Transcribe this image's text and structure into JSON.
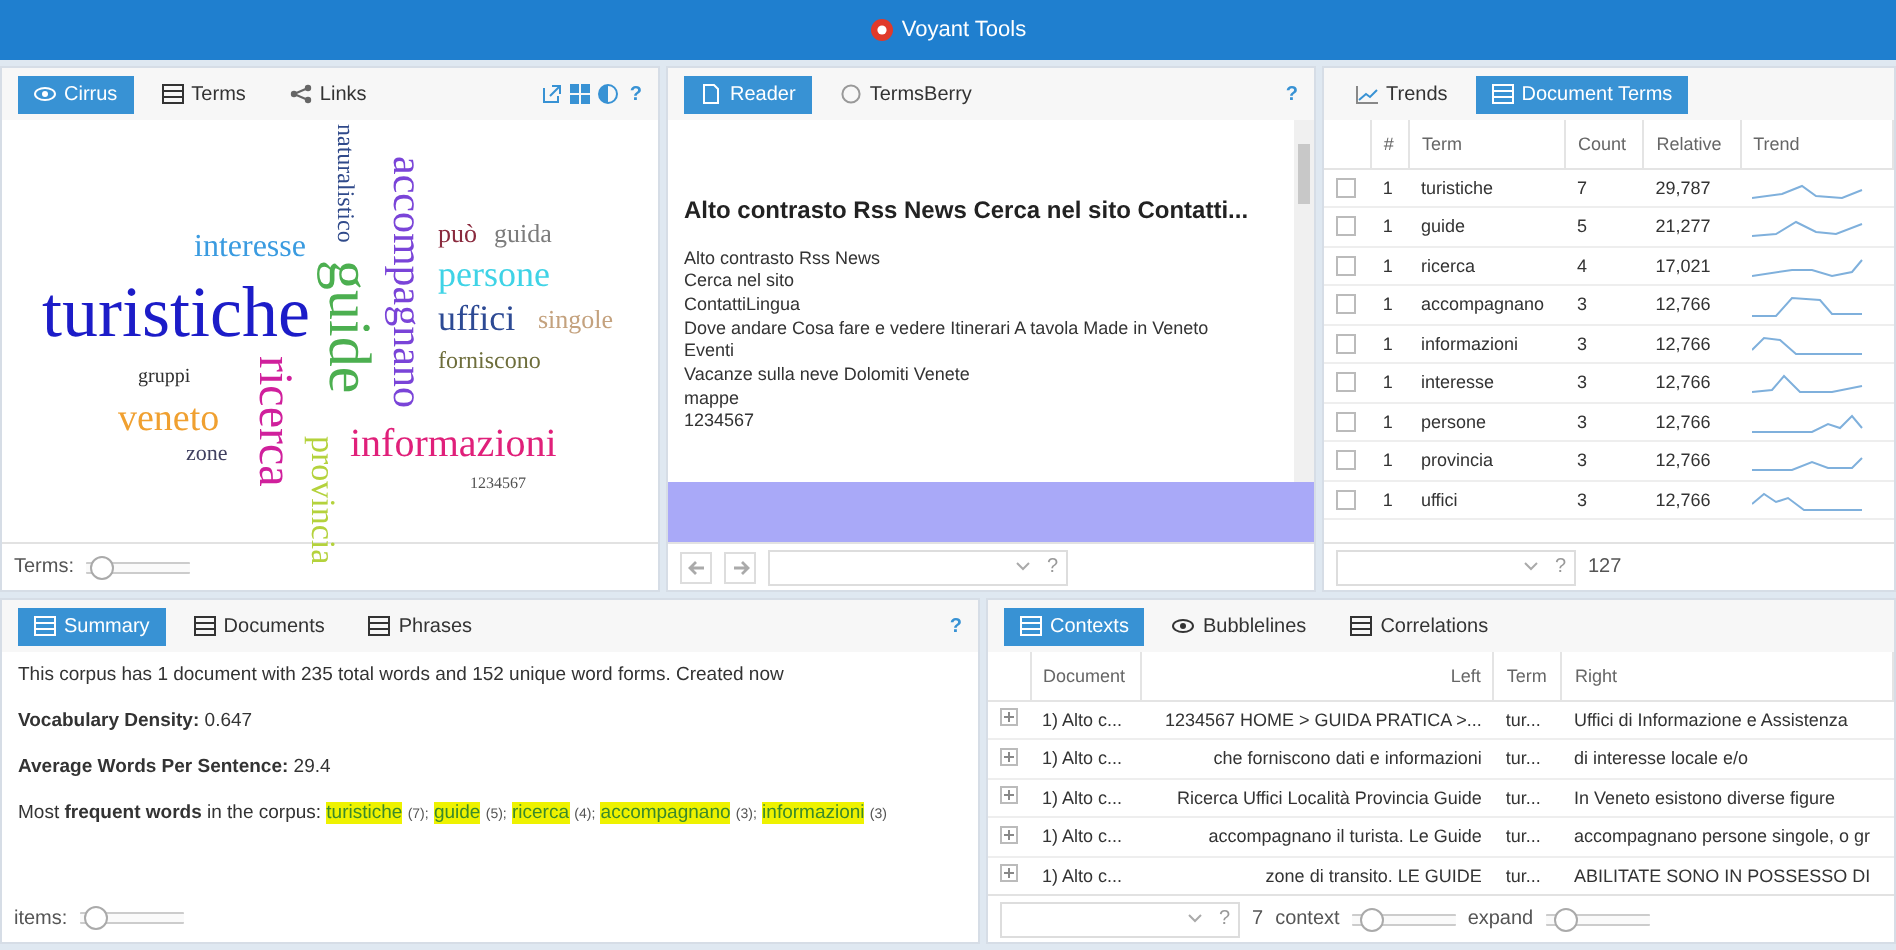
{
  "window": {
    "title": "Voyant Tools"
  },
  "cirrus": {
    "tabs": [
      {
        "label": "Cirrus",
        "selected": true
      },
      {
        "label": "Terms",
        "selected": false
      },
      {
        "label": "Links",
        "selected": false
      }
    ],
    "help": "?",
    "words": [
      {
        "text": "naturalistico",
        "color": "#304a8a"
      },
      {
        "text": "accompagnano",
        "color": "#7a44d8"
      },
      {
        "text": "può",
        "color": "#8a2a3e"
      },
      {
        "text": "guida",
        "color": "#7c7c7c"
      },
      {
        "text": "interesse",
        "color": "#3a9be0"
      },
      {
        "text": "persone",
        "color": "#3fd3e6"
      },
      {
        "text": "guide",
        "color": "#4caf50"
      },
      {
        "text": "turistiche",
        "color": "#1c1cc8"
      },
      {
        "text": "uffici",
        "color": "#2d4a94"
      },
      {
        "text": "singole",
        "color": "#c4a27e"
      },
      {
        "text": "forniscono",
        "color": "#6e6e3c"
      },
      {
        "text": "ricerca",
        "color": "#d0209c"
      },
      {
        "text": "gruppi",
        "color": "#303030"
      },
      {
        "text": "veneto",
        "color": "#f0a030"
      },
      {
        "text": "zone",
        "color": "#404060"
      },
      {
        "text": "informazioni",
        "color": "#e0207a"
      },
      {
        "text": "provincia",
        "color": "#b4d23c"
      },
      {
        "text": "1234567",
        "color": "#505050"
      }
    ],
    "slider": {
      "label": "Terms:",
      "level": 0.05
    }
  },
  "reader": {
    "tabs": [
      {
        "label": "Reader",
        "selected": true
      },
      {
        "label": "TermsBerry",
        "selected": false
      }
    ],
    "help": "?",
    "title": "Alto contrasto Rss News Cerca nel sito Contatti...",
    "lines": [
      "Alto contrasto Rss News",
      "Cerca nel sito",
      "ContattiLingua",
      "Dove andare Cosa fare e vedere Itinerari A tavola Made in Veneto",
      "Eventi",
      "Vacanze sulla neve Dolomiti Venete",
      "mappe",
      "1234567"
    ],
    "help_footer": "?"
  },
  "document_terms": {
    "tabs": [
      {
        "label": "Trends",
        "selected": false
      },
      {
        "label": "Document Terms",
        "selected": true
      }
    ],
    "columns": [
      "#",
      "Term",
      "Count",
      "Relative",
      "Trend"
    ],
    "rows": [
      {
        "checked": false,
        "doc": "1",
        "term": "turistiche",
        "count": "7",
        "relative": "29,787"
      },
      {
        "checked": false,
        "doc": "1",
        "term": "guide",
        "count": "5",
        "relative": "21,277"
      },
      {
        "checked": false,
        "doc": "1",
        "term": "ricerca",
        "count": "4",
        "relative": "17,021"
      },
      {
        "checked": false,
        "doc": "1",
        "term": "accompagnano",
        "count": "3",
        "relative": "12,766"
      },
      {
        "checked": false,
        "doc": "1",
        "term": "informazioni",
        "count": "3",
        "relative": "12,766"
      },
      {
        "checked": false,
        "doc": "1",
        "term": "interesse",
        "count": "3",
        "relative": "12,766"
      },
      {
        "checked": false,
        "doc": "1",
        "term": "persone",
        "count": "3",
        "relative": "12,766"
      },
      {
        "checked": false,
        "doc": "1",
        "term": "provincia",
        "count": "3",
        "relative": "12,766"
      },
      {
        "checked": false,
        "doc": "1",
        "term": "uffici",
        "count": "3",
        "relative": "12,766"
      }
    ],
    "help": "?",
    "total": "127"
  },
  "summary": {
    "tabs": [
      {
        "label": "Summary",
        "selected": true
      },
      {
        "label": "Documents",
        "selected": false
      },
      {
        "label": "Phrases",
        "selected": false
      }
    ],
    "help": "?",
    "intro": "This corpus has 1 document with 235 total words and 152 unique word forms. Created now",
    "density": "**Vocabulary Density:** 0.647",
    "average": "**Average Words Per Sentence:** 29.4",
    "frequent_label": "Most **frequent words** in the corpus:",
    "frequent": [
      {
        "term": "turistiche",
        "count": "(7);"
      },
      {
        "term": "guide",
        "count": "(5);"
      },
      {
        "term": "ricerca",
        "count": "(4);"
      },
      {
        "term": "accompagnano",
        "count": "(3);"
      },
      {
        "term": "informazioni",
        "count": "(3)"
      }
    ],
    "slider": {
      "label": "items:",
      "level": 0.05
    }
  },
  "contexts": {
    "tabs": [
      {
        "label": "Contexts",
        "selected": true
      },
      {
        "label": "Bubblelines",
        "selected": false
      },
      {
        "label": "Correlations",
        "selected": false
      }
    ],
    "columns": [
      "Document",
      "Left",
      "Term",
      "Right"
    ],
    "rows": [
      {
        "document": "1) Alto c...",
        "left": "1234567 HOME > GUIDA PRATICA >...",
        "term": "tur...",
        "right": "Uffici di Informazione e Assistenza"
      },
      {
        "document": "1) Alto c...",
        "left": "che forniscono dati e informazioni",
        "term": "tur...",
        "right": "di interesse locale e/o"
      },
      {
        "document": "1) Alto c...",
        "left": "Ricerca Uffici Località Provincia Guide",
        "term": "tur...",
        "right": "In Veneto esistono diverse figure"
      },
      {
        "document": "1) Alto c...",
        "left": "accompagnano il turista. Le Guide",
        "term": "tur...",
        "right": "accompagnano persone singole, o gr"
      },
      {
        "document": "1) Alto c...",
        "left": "zone di transito. LE GUIDE",
        "term": "tur...",
        "right": "ABILITATE SONO IN POSSESSO DI"
      }
    ],
    "help": "?",
    "count": "7",
    "context_slider": {
      "label": "context",
      "level": 0.1
    },
    "expand_slider": {
      "label": "expand",
      "level": 0.1
    }
  }
}
